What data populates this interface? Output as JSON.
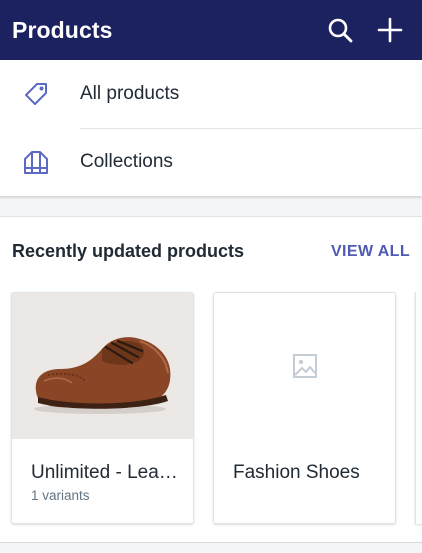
{
  "appbar": {
    "title": "Products",
    "search_icon": "search-icon",
    "add_icon": "plus-icon",
    "color": "#1c2160"
  },
  "menu": {
    "items": [
      {
        "label": "All products",
        "icon": "tag-icon"
      },
      {
        "label": "Collections",
        "icon": "collection-icon"
      }
    ]
  },
  "recent": {
    "title": "Recently updated products",
    "view_all_label": "VIEW ALL",
    "products": [
      {
        "name": "Unlimited - Lea…",
        "variants": "1 variants",
        "image": "brown-leather-brogue-shoe"
      },
      {
        "name": "Fashion Shoes",
        "variants": "",
        "image": "image-placeholder-icon"
      }
    ]
  },
  "colors": {
    "accent": "#4f5bb5",
    "icon": "#5c6ac4"
  }
}
